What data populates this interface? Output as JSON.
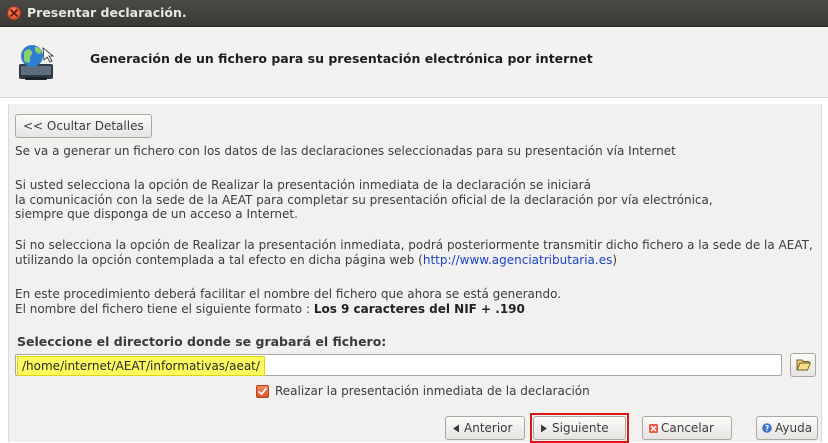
{
  "window": {
    "title": "Presentar declaración."
  },
  "header": {
    "icon": "globe-computer-icon",
    "title": "Generación de un fichero para su presentación electrónica por internet"
  },
  "details_button": "<< Ocultar Detalles",
  "paragraphs": {
    "p1": "Se va a generar un fichero con los datos de las declaraciones seleccionadas para su presentación vía Internet",
    "p2_l1": "Si usted selecciona la opción de Realizar la presentación inmediata de la declaración se iniciará",
    "p2_l2": "la comunicación con la sede de la AEAT para completar su presentación oficial de la declaración por vía electrónica,",
    "p2_l3": "siempre que disponga de un acceso a Internet.",
    "p3_l1": "Si no selecciona la opción de Realizar la presentación inmediata, podrá posteriormente transmitir dicho fichero a la sede de la AEAT,",
    "p3_l2_before": "utilizando la opción contemplada a tal efecto en dicha página web (",
    "p3_link": "http://www.agenciatributaria.es",
    "p3_l2_after": ")",
    "p4_l1": "En este procedimiento deberá facilitar el nombre del fichero que ahora se está generando.",
    "p4_l2_before": "El nombre del fichero tiene el siguiente formato : ",
    "p4_l2_bold": "Los 9 caracteres del NIF + .190"
  },
  "directory": {
    "label": "Seleccione el directorio donde se grabará el fichero:",
    "path": "/home/internet/AEAT/informativas/aeat/",
    "browse_icon": "open-folder-icon"
  },
  "checkbox": {
    "label": "Realizar la presentación inmediata de la declaración",
    "checked": true
  },
  "buttons": {
    "previous": "Anterior",
    "next": "Siguiente",
    "cancel": "Cancelar",
    "help": "Ayuda"
  },
  "colors": {
    "titlebar": "#3f3e3a",
    "highlight_path": "#fdfa5e",
    "next_button_outline": "#d81818",
    "accent_orange": "#e25a2b"
  }
}
